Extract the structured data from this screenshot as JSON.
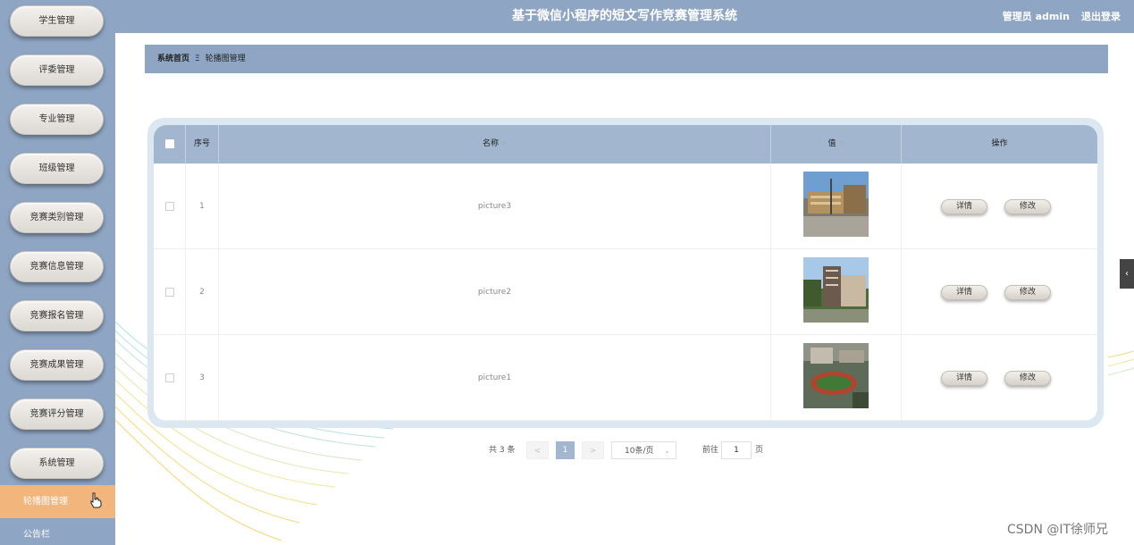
{
  "sidebar": {
    "items": [
      {
        "label": "学生管理"
      },
      {
        "label": "评委管理"
      },
      {
        "label": "专业管理"
      },
      {
        "label": "班级管理"
      },
      {
        "label": "竞赛类别管理"
      },
      {
        "label": "竞赛信息管理"
      },
      {
        "label": "竞赛报名管理"
      },
      {
        "label": "竞赛成果管理"
      },
      {
        "label": "竞赛评分管理"
      },
      {
        "label": "系统管理"
      }
    ],
    "active_label": "轮播图管理",
    "next_label": "公告栏"
  },
  "header": {
    "title": "基于微信小程序的短文写作竞赛管理系统",
    "user": "管理员 admin",
    "logout": "退出登录"
  },
  "breadcrumb": {
    "home": "系统首页",
    "separator": "Ξ",
    "current": "轮播图管理"
  },
  "table": {
    "headers": {
      "index": "序号",
      "name": "名称",
      "value": "值",
      "actions": "操作"
    },
    "rows": [
      {
        "index": "1",
        "name": "picture3",
        "detail": "详情",
        "edit": "修改"
      },
      {
        "index": "2",
        "name": "picture2",
        "detail": "详情",
        "edit": "修改"
      },
      {
        "index": "3",
        "name": "picture1",
        "detail": "详情",
        "edit": "修改"
      }
    ]
  },
  "pagination": {
    "total": "共 3 条",
    "prev": "<",
    "current": "1",
    "next": ">",
    "page_size": "10条/页",
    "goto": "前往",
    "goto_value": "1",
    "page_unit": "页"
  },
  "colors": {
    "theme": "#8ea5c3",
    "accent": "#f2b67c",
    "table_header": "#a2b7cf"
  },
  "watermark": "CSDN @IT徐师兄"
}
